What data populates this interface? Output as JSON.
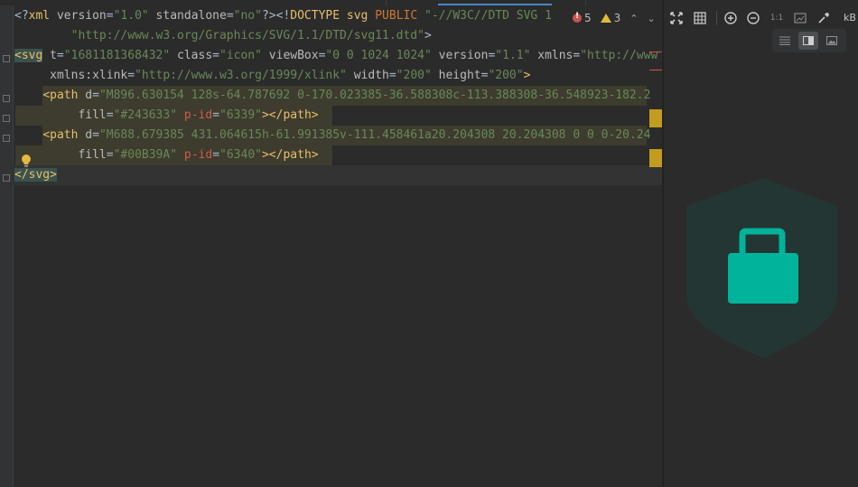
{
  "code_lines": [
    {
      "segments": [
        [
          "c-text",
          "<?"
        ],
        [
          "c-tag",
          "xml "
        ],
        [
          "c-attr",
          "version"
        ],
        [
          "c-text",
          "="
        ],
        [
          "c-str",
          "\"1.0\""
        ],
        [
          "c-attr",
          " standalone"
        ],
        [
          "c-text",
          "="
        ],
        [
          "c-str",
          "\"no\""
        ],
        [
          "c-text",
          "?>"
        ],
        [
          "c-text",
          "<!"
        ],
        [
          "c-tag",
          "DOCTYPE "
        ],
        [
          "c-tag",
          "svg "
        ],
        [
          "c-kw",
          "PUBLIC "
        ],
        [
          "c-str",
          "\"-//W3C//DTD SVG 1"
        ]
      ]
    },
    {
      "segments": [
        [
          "c-text",
          "        "
        ],
        [
          "c-str",
          "\"http://www.w3.org/Graphics/SVG/1.1/DTD/svg11.dtd\""
        ],
        [
          "c-text",
          ">"
        ]
      ]
    },
    {
      "segments": [
        [
          "c-brace",
          "<svg"
        ],
        [
          "c-attr",
          " t"
        ],
        [
          "c-text",
          "="
        ],
        [
          "c-str",
          "\"1681181368432\""
        ],
        [
          "c-attr",
          " class"
        ],
        [
          "c-text",
          "="
        ],
        [
          "c-str",
          "\"icon\""
        ],
        [
          "c-attr",
          " viewBox"
        ],
        [
          "c-text",
          "="
        ],
        [
          "c-str",
          "\"0 0 1024 1024\""
        ],
        [
          "c-attr",
          " version"
        ],
        [
          "c-text",
          "="
        ],
        [
          "c-str",
          "\"1.1\""
        ],
        [
          "c-attr",
          " xmlns"
        ],
        [
          "c-text",
          "="
        ],
        [
          "c-str",
          "\"http://www"
        ]
      ]
    },
    {
      "segments": [
        [
          "c-text",
          "     "
        ],
        [
          "c-attr",
          "xmlns:xlink"
        ],
        [
          "c-text",
          "="
        ],
        [
          "c-str",
          "\"http://www.w3.org/1999/xlink\""
        ],
        [
          "c-attr",
          " width"
        ],
        [
          "c-text",
          "="
        ],
        [
          "c-str",
          "\"200\""
        ],
        [
          "c-attr",
          " height"
        ],
        [
          "c-text",
          "="
        ],
        [
          "c-str",
          "\"200\""
        ],
        [
          "c-tag",
          ">"
        ]
      ]
    },
    {
      "segments": [
        [
          "c-text",
          "    "
        ],
        [
          "c-tag",
          "<path "
        ],
        [
          "c-attr",
          "d"
        ],
        [
          "c-text",
          "="
        ],
        [
          "c-str",
          "\"M896.630154 128s-64.787692 0-170.023385-36.588308c-113.388308-36.548923-182.2"
        ]
      ]
    },
    {
      "segments": [
        [
          "c-text",
          "         "
        ],
        [
          "c-attr",
          "fill"
        ],
        [
          "c-text",
          "="
        ],
        [
          "c-str",
          "\"#243633\""
        ],
        [
          "c-err",
          " p-id"
        ],
        [
          "c-text",
          "="
        ],
        [
          "c-str",
          "\"6339\""
        ],
        [
          "c-tag",
          "></path>"
        ]
      ]
    },
    {
      "segments": [
        [
          "c-text",
          "    "
        ],
        [
          "c-tag",
          "<path "
        ],
        [
          "c-attr",
          "d"
        ],
        [
          "c-text",
          "="
        ],
        [
          "c-str",
          "\"M688.679385 431.064615h-61.991385v-111.458461a20.204308 20.204308 0 0 0-20.24"
        ]
      ]
    },
    {
      "segments": [
        [
          "c-text",
          "         "
        ],
        [
          "c-attr",
          "fill"
        ],
        [
          "c-text",
          "="
        ],
        [
          "c-str",
          "\"#00B39A\""
        ],
        [
          "c-err",
          " p-id"
        ],
        [
          "c-text",
          "="
        ],
        [
          "c-str",
          "\"6340\""
        ],
        [
          "c-tag",
          "></path>"
        ]
      ]
    },
    {
      "segments": [
        [
          "c-brace",
          "</svg>"
        ]
      ]
    }
  ],
  "inspections": {
    "errors": "5",
    "warnings": "3"
  },
  "icon_colors": {
    "shield": "#243633",
    "lock": "#00B39A"
  },
  "preview_toolbar": {
    "zoom_label": "1:1",
    "size_label": "kB"
  }
}
